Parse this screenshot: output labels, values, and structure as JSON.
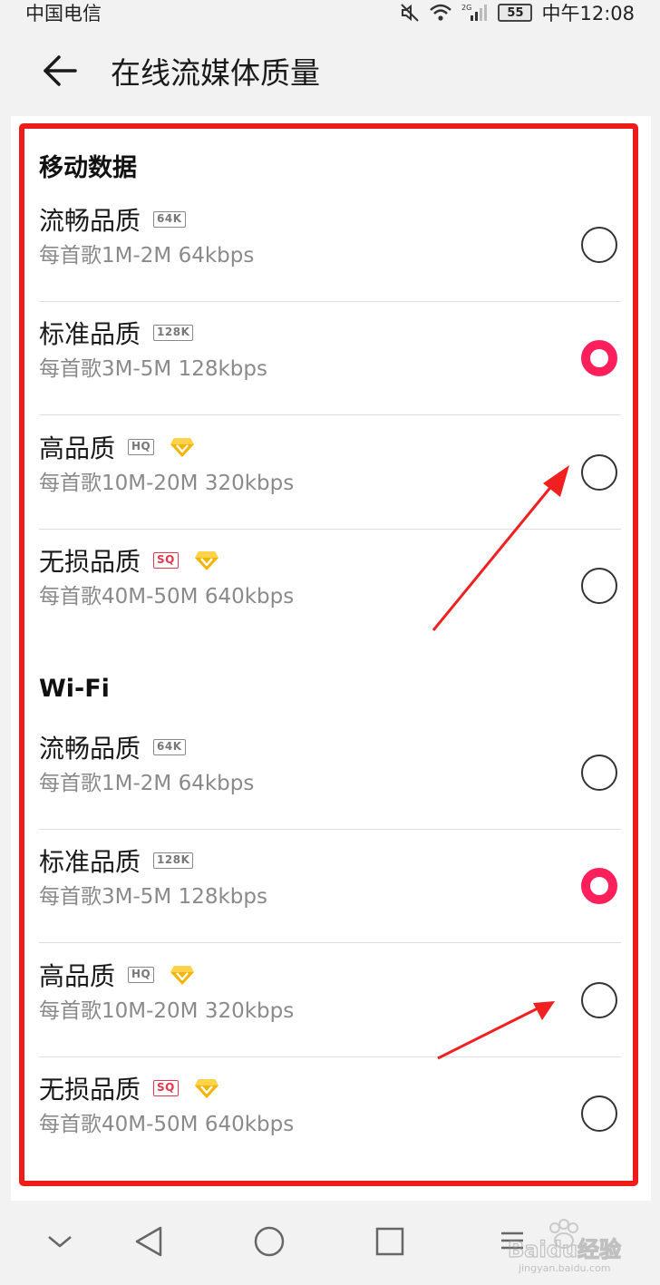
{
  "status_bar": {
    "carrier": "中国电信",
    "network": "2G",
    "battery": "55",
    "time": "中午12:08"
  },
  "header": {
    "title": "在线流媒体质量"
  },
  "sections": [
    {
      "title": "移动数据",
      "options": [
        {
          "label": "流畅品质",
          "tag": "64K",
          "vip": false,
          "desc": "每首歌1M-2M 64kbps",
          "selected": false
        },
        {
          "label": "标准品质",
          "tag": "128K",
          "vip": false,
          "desc": "每首歌3M-5M 128kbps",
          "selected": true
        },
        {
          "label": "高品质",
          "tag": "HQ",
          "vip": true,
          "desc": "每首歌10M-20M 320kbps",
          "selected": false
        },
        {
          "label": "无损品质",
          "tag": "SQ",
          "vip": true,
          "desc": "每首歌40M-50M 640kbps",
          "selected": false
        }
      ]
    },
    {
      "title": "Wi-Fi",
      "options": [
        {
          "label": "流畅品质",
          "tag": "64K",
          "vip": false,
          "desc": "每首歌1M-2M 64kbps",
          "selected": false
        },
        {
          "label": "标准品质",
          "tag": "128K",
          "vip": false,
          "desc": "每首歌3M-5M 128kbps",
          "selected": true
        },
        {
          "label": "高品质",
          "tag": "HQ",
          "vip": true,
          "desc": "每首歌10M-20M 320kbps",
          "selected": false
        },
        {
          "label": "无损品质",
          "tag": "SQ",
          "vip": true,
          "desc": "每首歌40M-50M 640kbps",
          "selected": false
        }
      ]
    }
  ],
  "watermark": {
    "brand": "Baidu经验",
    "url": "jingyan.baidu.com"
  },
  "colors": {
    "accent": "#ff1f5a",
    "highlight_frame": "#ef1c1c",
    "vip_gold": "#f5b400"
  }
}
